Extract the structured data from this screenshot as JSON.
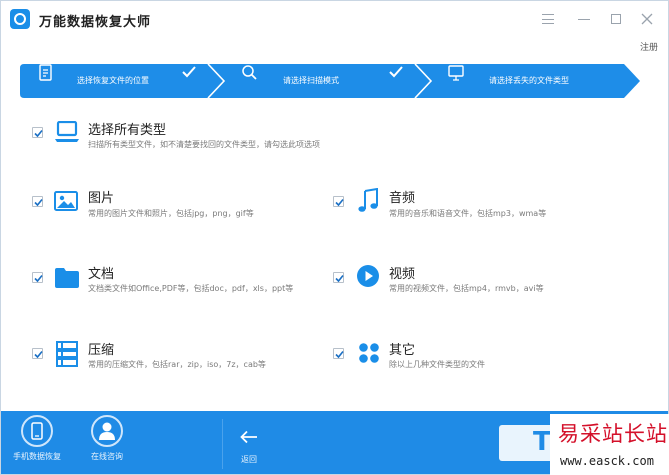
{
  "window": {
    "title": "万能数据恢复大师",
    "register_label": "注册"
  },
  "steps": [
    {
      "label": "选择恢复文件的位置",
      "icon": "file-icon",
      "completed": true
    },
    {
      "label": "请选择扫描模式",
      "icon": "search-icon",
      "completed": true
    },
    {
      "label": "请选择丢失的文件类型",
      "icon": "monitor-icon",
      "completed": false
    }
  ],
  "options": {
    "all": {
      "title": "选择所有类型",
      "desc": "扫描所有类型文件，如不清楚要找回的文件类型，请勾选此项选项",
      "icon": "laptop-icon",
      "checked": true
    },
    "images": {
      "title": "图片",
      "desc": "常用的图片文件和照片，包括jpg，png，gif等",
      "icon": "image-icon",
      "checked": true
    },
    "audio": {
      "title": "音频",
      "desc": "常用的音乐和语音文件，包括mp3，wma等",
      "icon": "music-note-icon",
      "checked": true
    },
    "docs": {
      "title": "文档",
      "desc": "文档类文件如Office,PDF等，包括doc，pdf，xls，ppt等",
      "icon": "folder-icon",
      "checked": true
    },
    "video": {
      "title": "视频",
      "desc": "常用的视频文件，包括mp4，rmvb，avi等",
      "icon": "play-icon",
      "checked": true
    },
    "archive": {
      "title": "压缩",
      "desc": "常用的压缩文件，包括rar，zip，iso，7z，cab等",
      "icon": "archive-icon",
      "checked": true
    },
    "other": {
      "title": "其它",
      "desc": "除以上几种文件类型的文件",
      "icon": "grid-icon",
      "checked": true
    }
  },
  "bottombar": {
    "phone_recovery_label": "手机数据恢复",
    "online_consult_label": "在线咨询",
    "back_label": "返回",
    "next_glyph": "T"
  },
  "watermark": {
    "cn": "易采站长站",
    "url": "www.easck.com"
  },
  "colors": {
    "accent": "#1f8be6",
    "step_bar": "#1e8de8",
    "icon_blue": "#1a8ee8",
    "watermark_red": "#d4102a"
  }
}
